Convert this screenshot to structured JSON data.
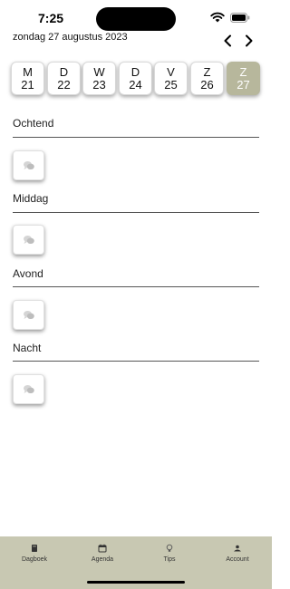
{
  "status_bar": {
    "time": "7:25"
  },
  "header": {
    "date": "zondag 27 augustus 2023",
    "prev_label": "<",
    "next_label": ">"
  },
  "days": [
    {
      "letter": "M",
      "number": "21",
      "selected": false
    },
    {
      "letter": "D",
      "number": "22",
      "selected": false
    },
    {
      "letter": "W",
      "number": "23",
      "selected": false
    },
    {
      "letter": "D",
      "number": "24",
      "selected": false
    },
    {
      "letter": "V",
      "number": "25",
      "selected": false
    },
    {
      "letter": "Z",
      "number": "26",
      "selected": false
    },
    {
      "letter": "Z",
      "number": "27",
      "selected": true
    }
  ],
  "sections": [
    {
      "title": "Ochtend",
      "icon": "comment-icon"
    },
    {
      "title": "Middag",
      "icon": "comment-icon"
    },
    {
      "title": "Avond",
      "icon": "comment-icon"
    },
    {
      "title": "Nacht",
      "icon": "comment-icon"
    }
  ],
  "tab_bar": {
    "tabs": [
      {
        "label": "Dagboek",
        "icon": "book-icon"
      },
      {
        "label": "Agenda",
        "icon": "calendar-icon"
      },
      {
        "label": "Tips",
        "icon": "lightbulb-icon"
      },
      {
        "label": "Account",
        "icon": "account-icon"
      }
    ]
  },
  "colors": {
    "selected_day": "#b7b79c",
    "tab_bar_background": "#c8c8b2"
  }
}
